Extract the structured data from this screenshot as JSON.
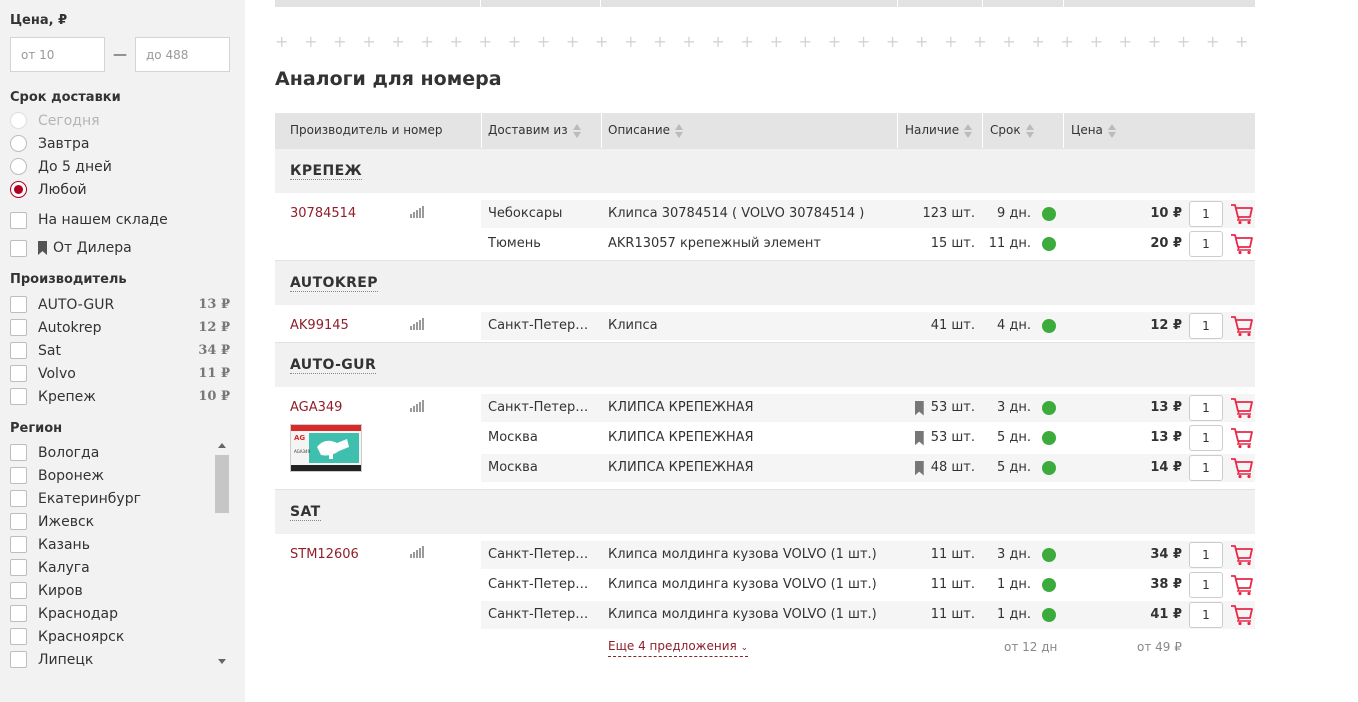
{
  "sidebar": {
    "price": {
      "title": "Цена, ₽",
      "from_placeholder": "от 10",
      "to_placeholder": "до 488",
      "dash": "—"
    },
    "delivery": {
      "title": "Срок доставки",
      "options": [
        {
          "label": "Сегодня",
          "state": "disabled"
        },
        {
          "label": "Завтра",
          "state": "unchecked"
        },
        {
          "label": "До 5 дней",
          "state": "unchecked"
        },
        {
          "label": "Любой",
          "state": "checked"
        }
      ]
    },
    "stock": {
      "warehouse_label": "На нашем складе",
      "dealer_label": "От Дилера"
    },
    "manufacturer": {
      "title": "Производитель",
      "items": [
        {
          "label": "AUTO-GUR",
          "price": "13 ₽"
        },
        {
          "label": "Autokrep",
          "price": "12 ₽"
        },
        {
          "label": "Sat",
          "price": "34 ₽"
        },
        {
          "label": "Volvo",
          "price": "11 ₽"
        },
        {
          "label": "Крепеж",
          "price": "10 ₽"
        }
      ]
    },
    "region": {
      "title": "Регион",
      "items": [
        "Вологда",
        "Воронеж",
        "Екатеринбург",
        "Ижевск",
        "Казань",
        "Калуга",
        "Киров",
        "Краснодар",
        "Красноярск",
        "Липецк"
      ]
    }
  },
  "main": {
    "title": "Аналоги для номера",
    "plus_row": "+ + + + + + + + + + + + + + + + + + + + + + + + + + + + + + + + + + + + + + + + + + + + + + + + + + + + + + + + + + + + + + + +",
    "columns": [
      "Производитель и номер",
      "Доставим из",
      "Описание",
      "Наличие",
      "Срок",
      "Цена"
    ],
    "groups": [
      {
        "name": "КРЕПЕЖ",
        "part_no": "30784514",
        "offers": [
          {
            "city": "Чебоксары",
            "desc": "Клипса 30784514 ( VOLVO 30784514 )",
            "stock": "123 шт.",
            "term": "9 дн.",
            "price": "10 ₽",
            "qty": "1",
            "dealer": false
          },
          {
            "city": "Тюмень",
            "desc": "AKR13057 крепежный элемент",
            "stock": "15 шт.",
            "term": "11 дн.",
            "price": "20 ₽",
            "qty": "1",
            "dealer": false
          }
        ]
      },
      {
        "name": "AUTOKREP",
        "part_no": "AK99145",
        "offers": [
          {
            "city": "Санкт-Петербург",
            "desc": "Клипса",
            "stock": "41 шт.",
            "term": "4 дн.",
            "price": "12 ₽",
            "qty": "1",
            "dealer": false
          }
        ]
      },
      {
        "name": "AUTO-GUR",
        "part_no": "AGA349",
        "offers": [
          {
            "city": "Санкт-Петербург",
            "desc": "КЛИПСА КРЕПЕЖНАЯ",
            "stock": "53 шт.",
            "term": "3 дн.",
            "price": "13 ₽",
            "qty": "1",
            "dealer": true
          },
          {
            "city": "Москва",
            "desc": "КЛИПСА КРЕПЕЖНАЯ",
            "stock": "53 шт.",
            "term": "5 дн.",
            "price": "13 ₽",
            "qty": "1",
            "dealer": true
          },
          {
            "city": "Москва",
            "desc": "КЛИПСА КРЕПЕЖНАЯ",
            "stock": "48 шт.",
            "term": "5 дн.",
            "price": "14 ₽",
            "qty": "1",
            "dealer": true
          }
        ]
      },
      {
        "name": "SAT",
        "part_no": "STM12606",
        "offers": [
          {
            "city": "Санкт-Петербург",
            "desc": "Клипса молдинга кузова VOLVO (1 шт.)",
            "stock": "11 шт.",
            "term": "3 дн.",
            "price": "34 ₽",
            "qty": "1",
            "dealer": false
          },
          {
            "city": "Санкт-Петербург",
            "desc": "Клипса молдинга кузова VOLVO (1 шт.)",
            "stock": "11 шт.",
            "term": "1 дн.",
            "price": "38 ₽",
            "qty": "1",
            "dealer": false
          },
          {
            "city": "Санкт-Петербург",
            "desc": "Клипса молдинга кузова VOLVO (1 шт.)",
            "stock": "11 шт.",
            "term": "1 дн.",
            "price": "41 ₽",
            "qty": "1",
            "dealer": false
          }
        ]
      }
    ],
    "more": {
      "link": "Еще 4 предложения",
      "term": "от 12 дн",
      "price": "от 49 ₽"
    },
    "thumb_brand": "AG",
    "thumb_code": "AGA349",
    "colors": {
      "accent": "#8f1f2b",
      "available": "#3cab3c",
      "cart": "#e8294a"
    }
  }
}
